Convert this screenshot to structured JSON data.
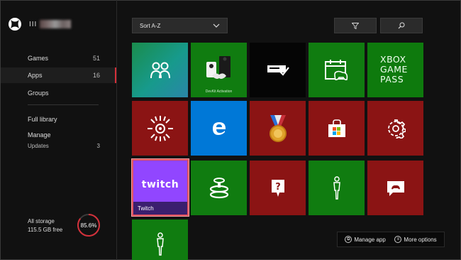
{
  "profile": {
    "gamertag_visible": "III"
  },
  "sidebar": {
    "nav": [
      {
        "label": "Games",
        "count": "51"
      },
      {
        "label": "Apps",
        "count": "16"
      },
      {
        "label": "Groups",
        "count": ""
      }
    ],
    "full_library": "Full library",
    "manage": "Manage",
    "updates": {
      "label": "Updates",
      "count": "3"
    },
    "storage": {
      "label": "All storage",
      "free": "115.5 GB free",
      "percent_text": "85.6%",
      "percent": 85.6
    }
  },
  "toolbar": {
    "sort_label": "Sort A-Z",
    "filter_icon": "filter-icon",
    "search_icon": "search-icon"
  },
  "tiles": {
    "devkit_caption": "DevKit Activation",
    "gamepass_lines": [
      "XBOX",
      "GAME",
      "PASS"
    ],
    "twitch_logo": "twitch",
    "twitch_label": "Twitch"
  },
  "hints": {
    "manage_app": "Manage app",
    "more_options": "More options"
  },
  "colors": {
    "accent": "#d4303a",
    "green": "#107c10",
    "red": "#8b1414",
    "blue": "#0078d7",
    "twitch": "#9146ff"
  }
}
